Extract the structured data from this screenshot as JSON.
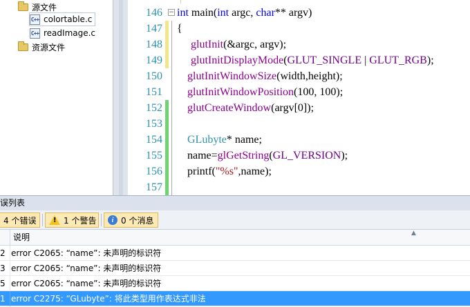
{
  "explorer": {
    "items": [
      {
        "label": "源文件",
        "type": "folder"
      },
      {
        "label": "colortable.c",
        "type": "file"
      },
      {
        "label": "readImage.c",
        "type": "file"
      },
      {
        "label": "资源文件",
        "type": "folder"
      }
    ]
  },
  "editor": {
    "lines": [
      {
        "num": "146"
      },
      {
        "num": "147"
      },
      {
        "num": "148"
      },
      {
        "num": "149"
      },
      {
        "num": "150"
      },
      {
        "num": "151"
      },
      {
        "num": "152"
      },
      {
        "num": "153"
      },
      {
        "num": "154"
      },
      {
        "num": "155"
      },
      {
        "num": "156"
      },
      {
        "num": "157"
      }
    ],
    "code": {
      "l146_kw_int": "int",
      "l146_main": " main(",
      "l146_kw_int2": "int",
      "l146_argc": " argc, ",
      "l146_kw_char": "char",
      "l146_rest": "** argv)",
      "l147": "{",
      "l148_fn": "glutInit",
      "l148_rest": "(&argc, argv);",
      "l149_fn": "glutInitDisplayMode",
      "l149_open": "(",
      "l149_m1": "GLUT_SINGLE",
      "l149_pipe": " | ",
      "l149_m2": "GLUT_RGB",
      "l149_close": ");",
      "l150_fn": "glutInitWindowSize",
      "l150_rest": "(width,height);",
      "l151_fn": "glutInitWindowPosition",
      "l151_rest": "(100, 100);",
      "l152_fn": "glutCreateWindow",
      "l152_rest": "(argv[0]);",
      "l154_ty": "GLubyte",
      "l154_rest": "* name;",
      "l155_a": "name=",
      "l155_fn": "glGetString",
      "l155_open": "(",
      "l155_mc": "GL_VERSION",
      "l155_close": ");",
      "l156_a": "printf(",
      "l156_st": "\"%s\"",
      "l156_rest": ",name);"
    }
  },
  "error_list": {
    "title": "误列表",
    "filters": {
      "errors": "4 个错误",
      "warnings": "1 个警告",
      "messages": "0 个消息"
    },
    "header": {
      "description": "说明"
    },
    "rows": [
      {
        "num": "2",
        "desc": "error C2065: “name”: 未声明的标识符"
      },
      {
        "num": "3",
        "desc": "error C2065: “name”: 未声明的标识符"
      },
      {
        "num": "5",
        "desc": "error C2065: “name”: 未声明的标识符"
      },
      {
        "num": "1",
        "desc": "error C2275: “GLubyte”: 将此类型用作表达式非法"
      }
    ]
  },
  "colors": {
    "line_number": "#2b91af",
    "keyword": "#0000ff",
    "function": "#8b008b",
    "macro": "#6f008a",
    "string": "#a31515",
    "changed_unsaved": "#f3e68a",
    "changed_saved": "#6fd36f",
    "selection": "#3399ff"
  }
}
